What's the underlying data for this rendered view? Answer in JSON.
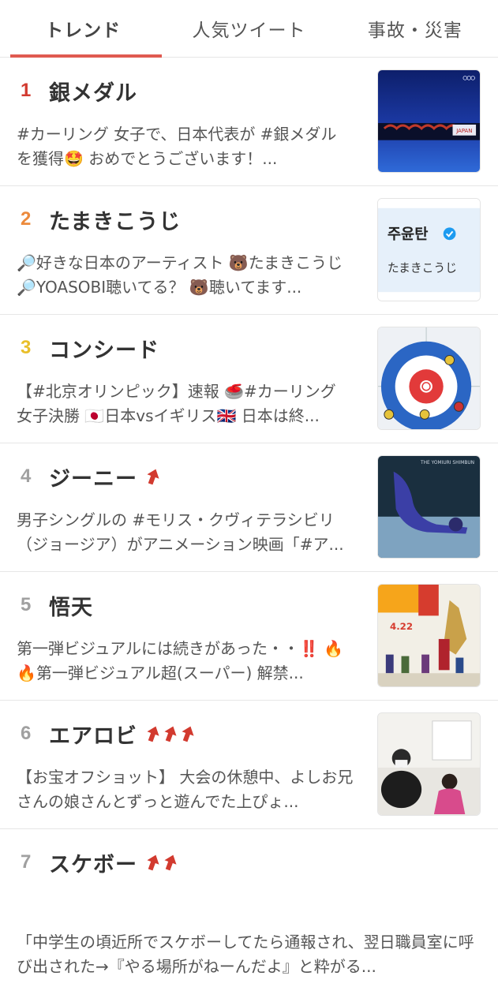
{
  "tabs": [
    {
      "label": "トレンド",
      "active": true
    },
    {
      "label": "人気ツイート",
      "active": false
    },
    {
      "label": "事故・災害",
      "active": false
    }
  ],
  "trends": [
    {
      "rank": "1",
      "title": "銀メダル",
      "rank_color": "#d23a2f",
      "arrows": 0,
      "desc": "#カーリング 女子で、日本代表が #銀メダル を獲得🤩 おめでとうございます！...",
      "thumb_icon": "olympic-curling-photo",
      "thumb_text": "JAPAN"
    },
    {
      "rank": "2",
      "title": "たまきこうじ",
      "rank_color": "#ec8a3c",
      "arrows": 0,
      "desc": "🔎好きな日本のアーティスト 🐻たまきこうじ 🔎YOASOBI聴いてる？ 🐻聴いてます...",
      "thumb_icon": "profile-card",
      "thumb_name": "주윤탄",
      "thumb_sub": "たまきこうじ"
    },
    {
      "rank": "3",
      "title": "コンシード",
      "rank_color": "#e9bf2a",
      "arrows": 0,
      "desc": "【#北京オリンピック】速報 🥌#カーリング 女子決勝 🇯🇵日本vsイギリス🇬🇧 日本は終...",
      "thumb_icon": "curling-house"
    },
    {
      "rank": "4",
      "title": "ジーニー",
      "rank_color": "#a0a0a0",
      "arrows": 1,
      "desc": "男子シングルの #モリス・クヴィテラシビリ（ジョージア）がアニメーション映画「#ア...",
      "thumb_icon": "figure-skater-photo",
      "thumb_text": "THE YOMIURI SHIMBUN"
    },
    {
      "rank": "5",
      "title": "悟天",
      "rank_color": "#a0a0a0",
      "arrows": 0,
      "desc": "第一弾ビジュアルには続きがあった・・‼️ 🔥🔥第一弾ビジュアル超(スーパー) 解禁...",
      "thumb_icon": "anime-poster",
      "thumb_text": "4.22"
    },
    {
      "rank": "6",
      "title": "エアロビ",
      "rank_color": "#a0a0a0",
      "arrows": 3,
      "desc": "【お宝オフショット】 大会の休憩中、よしお兄さんの娘さんとずっと遊んでた上ぴょ...",
      "thumb_icon": "offshot-photo"
    },
    {
      "rank": "7",
      "title": "スケボー",
      "rank_color": "#a0a0a0",
      "arrows": 2,
      "desc": "「中学生の頃近所でスケボーしてたら通報され、翌日職員室に呼び出された→『やる場所がねーんだよ』と粋がる...",
      "thumb_icon": ""
    }
  ],
  "colors": {
    "accent": "#e05a50",
    "arrow": "#d23a2f"
  }
}
